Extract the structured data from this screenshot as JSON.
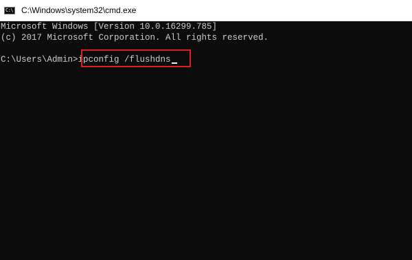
{
  "window": {
    "title": "C:\\Windows\\system32\\cmd.exe",
    "icon": "cmd-icon",
    "icon_glyph": "C:\\"
  },
  "console": {
    "line1": "Microsoft Windows [Version 10.0.16299.785]",
    "line2": "(c) 2017 Microsoft Corporation. All rights reserved.",
    "prompt": "C:\\Users\\Admin>",
    "command": "ipconfig /flushdns"
  },
  "colors": {
    "console_background": "#0c0c0c",
    "console_text": "#cccccc",
    "highlight": "#e02020"
  }
}
